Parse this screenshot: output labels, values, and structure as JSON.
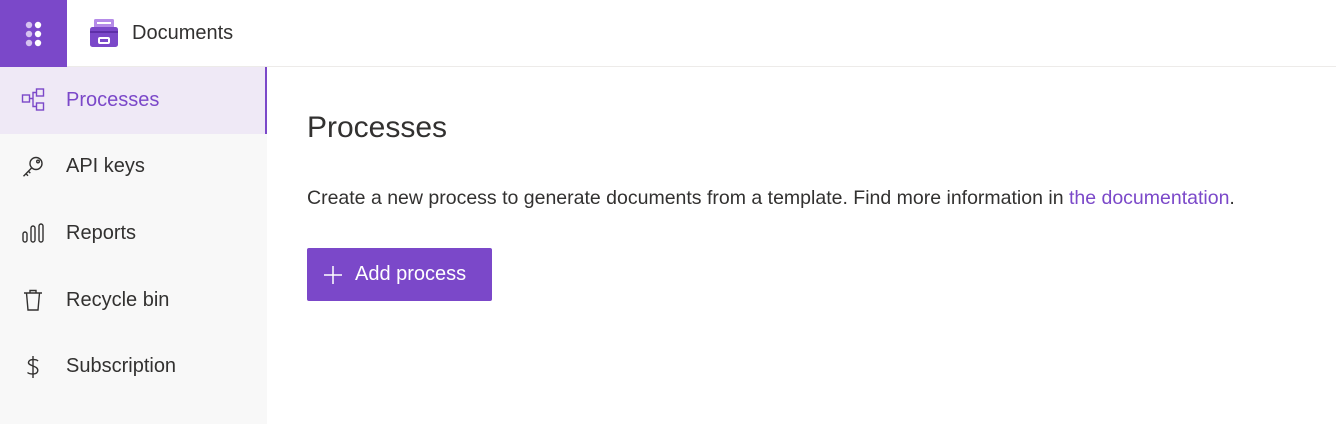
{
  "app": {
    "title": "Documents",
    "launcher_icon": "waffle-icon",
    "brand_icon": "document-cabinet-icon"
  },
  "colors": {
    "accent": "#7b48c9",
    "sidebar_bg": "#f8f8f8",
    "active_bg": "#efe9f6",
    "text": "#323130"
  },
  "sidebar": {
    "items": [
      {
        "label": "Processes",
        "icon": "process-flow-icon",
        "active": true
      },
      {
        "label": "API keys",
        "icon": "key-icon",
        "active": false
      },
      {
        "label": "Reports",
        "icon": "bar-chart-icon",
        "active": false
      },
      {
        "label": "Recycle bin",
        "icon": "trash-icon",
        "active": false
      },
      {
        "label": "Subscription",
        "icon": "dollar-icon",
        "active": false
      }
    ]
  },
  "main": {
    "title": "Processes",
    "description_prefix": "Create a new process to generate documents from a template. Find more information in ",
    "description_link": "the documentation",
    "description_suffix": ".",
    "add_button_label": "Add process",
    "add_button_icon": "plus-icon"
  }
}
